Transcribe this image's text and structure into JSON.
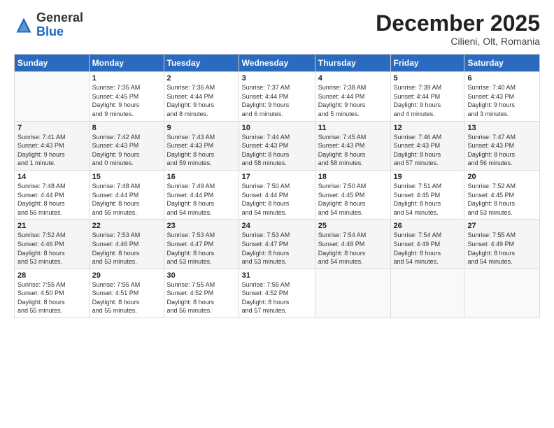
{
  "header": {
    "logo_general": "General",
    "logo_blue": "Blue",
    "month_title": "December 2025",
    "location": "Cilieni, Olt, Romania"
  },
  "weekdays": [
    "Sunday",
    "Monday",
    "Tuesday",
    "Wednesday",
    "Thursday",
    "Friday",
    "Saturday"
  ],
  "weeks": [
    [
      {
        "day": "",
        "info": ""
      },
      {
        "day": "1",
        "info": "Sunrise: 7:35 AM\nSunset: 4:45 PM\nDaylight: 9 hours\nand 9 minutes."
      },
      {
        "day": "2",
        "info": "Sunrise: 7:36 AM\nSunset: 4:44 PM\nDaylight: 9 hours\nand 8 minutes."
      },
      {
        "day": "3",
        "info": "Sunrise: 7:37 AM\nSunset: 4:44 PM\nDaylight: 9 hours\nand 6 minutes."
      },
      {
        "day": "4",
        "info": "Sunrise: 7:38 AM\nSunset: 4:44 PM\nDaylight: 9 hours\nand 5 minutes."
      },
      {
        "day": "5",
        "info": "Sunrise: 7:39 AM\nSunset: 4:44 PM\nDaylight: 9 hours\nand 4 minutes."
      },
      {
        "day": "6",
        "info": "Sunrise: 7:40 AM\nSunset: 4:43 PM\nDaylight: 9 hours\nand 3 minutes."
      }
    ],
    [
      {
        "day": "7",
        "info": "Sunrise: 7:41 AM\nSunset: 4:43 PM\nDaylight: 9 hours\nand 1 minute."
      },
      {
        "day": "8",
        "info": "Sunrise: 7:42 AM\nSunset: 4:43 PM\nDaylight: 9 hours\nand 0 minutes."
      },
      {
        "day": "9",
        "info": "Sunrise: 7:43 AM\nSunset: 4:43 PM\nDaylight: 8 hours\nand 59 minutes."
      },
      {
        "day": "10",
        "info": "Sunrise: 7:44 AM\nSunset: 4:43 PM\nDaylight: 8 hours\nand 58 minutes."
      },
      {
        "day": "11",
        "info": "Sunrise: 7:45 AM\nSunset: 4:43 PM\nDaylight: 8 hours\nand 58 minutes."
      },
      {
        "day": "12",
        "info": "Sunrise: 7:46 AM\nSunset: 4:43 PM\nDaylight: 8 hours\nand 57 minutes."
      },
      {
        "day": "13",
        "info": "Sunrise: 7:47 AM\nSunset: 4:43 PM\nDaylight: 8 hours\nand 56 minutes."
      }
    ],
    [
      {
        "day": "14",
        "info": "Sunrise: 7:48 AM\nSunset: 4:44 PM\nDaylight: 8 hours\nand 56 minutes."
      },
      {
        "day": "15",
        "info": "Sunrise: 7:48 AM\nSunset: 4:44 PM\nDaylight: 8 hours\nand 55 minutes."
      },
      {
        "day": "16",
        "info": "Sunrise: 7:49 AM\nSunset: 4:44 PM\nDaylight: 8 hours\nand 54 minutes."
      },
      {
        "day": "17",
        "info": "Sunrise: 7:50 AM\nSunset: 4:44 PM\nDaylight: 8 hours\nand 54 minutes."
      },
      {
        "day": "18",
        "info": "Sunrise: 7:50 AM\nSunset: 4:45 PM\nDaylight: 8 hours\nand 54 minutes."
      },
      {
        "day": "19",
        "info": "Sunrise: 7:51 AM\nSunset: 4:45 PM\nDaylight: 8 hours\nand 54 minutes."
      },
      {
        "day": "20",
        "info": "Sunrise: 7:52 AM\nSunset: 4:45 PM\nDaylight: 8 hours\nand 53 minutes."
      }
    ],
    [
      {
        "day": "21",
        "info": "Sunrise: 7:52 AM\nSunset: 4:46 PM\nDaylight: 8 hours\nand 53 minutes."
      },
      {
        "day": "22",
        "info": "Sunrise: 7:53 AM\nSunset: 4:46 PM\nDaylight: 8 hours\nand 53 minutes."
      },
      {
        "day": "23",
        "info": "Sunrise: 7:53 AM\nSunset: 4:47 PM\nDaylight: 8 hours\nand 53 minutes."
      },
      {
        "day": "24",
        "info": "Sunrise: 7:53 AM\nSunset: 4:47 PM\nDaylight: 8 hours\nand 53 minutes."
      },
      {
        "day": "25",
        "info": "Sunrise: 7:54 AM\nSunset: 4:48 PM\nDaylight: 8 hours\nand 54 minutes."
      },
      {
        "day": "26",
        "info": "Sunrise: 7:54 AM\nSunset: 4:49 PM\nDaylight: 8 hours\nand 54 minutes."
      },
      {
        "day": "27",
        "info": "Sunrise: 7:55 AM\nSunset: 4:49 PM\nDaylight: 8 hours\nand 54 minutes."
      }
    ],
    [
      {
        "day": "28",
        "info": "Sunrise: 7:55 AM\nSunset: 4:50 PM\nDaylight: 8 hours\nand 55 minutes."
      },
      {
        "day": "29",
        "info": "Sunrise: 7:55 AM\nSunset: 4:51 PM\nDaylight: 8 hours\nand 55 minutes."
      },
      {
        "day": "30",
        "info": "Sunrise: 7:55 AM\nSunset: 4:52 PM\nDaylight: 8 hours\nand 56 minutes."
      },
      {
        "day": "31",
        "info": "Sunrise: 7:55 AM\nSunset: 4:52 PM\nDaylight: 8 hours\nand 57 minutes."
      },
      {
        "day": "",
        "info": ""
      },
      {
        "day": "",
        "info": ""
      },
      {
        "day": "",
        "info": ""
      }
    ]
  ]
}
